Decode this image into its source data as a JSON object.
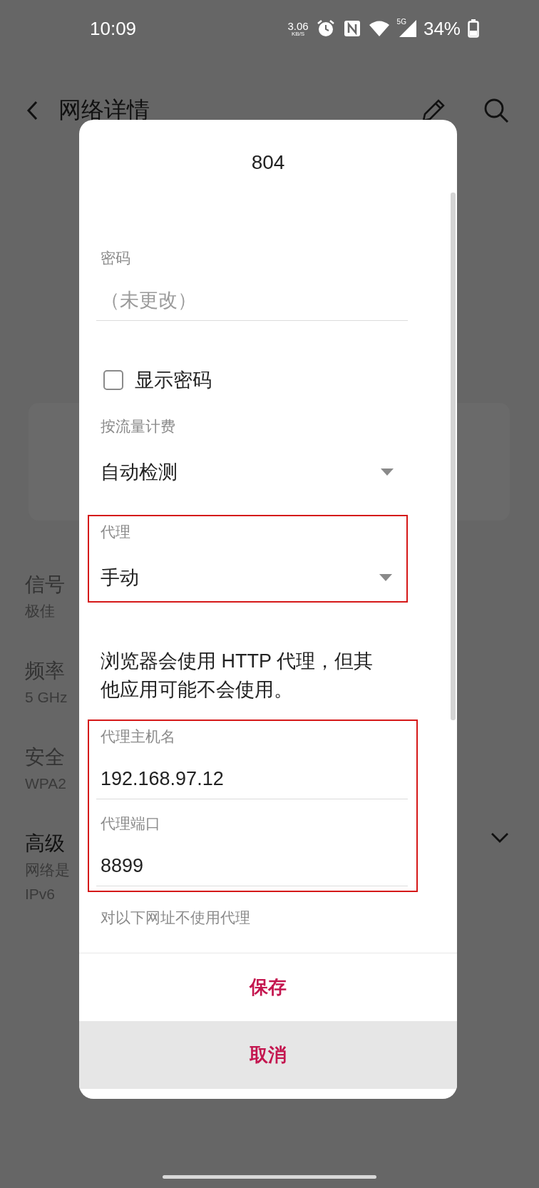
{
  "status_bar": {
    "time": "10:09",
    "net_speed": "3.06",
    "net_speed_unit": "KB/S",
    "network": "5G",
    "battery": "34%"
  },
  "page": {
    "title": "网络详情",
    "items": [
      {
        "label": "信号",
        "value": "极佳"
      },
      {
        "label": "频率",
        "value": "5 GHz"
      },
      {
        "label": "安全",
        "value": "WPA2"
      }
    ],
    "advanced": {
      "label": "高级",
      "lines": [
        "网络是",
        "IPv6"
      ]
    }
  },
  "dialog": {
    "title": "804",
    "password": {
      "label": "密码",
      "placeholder": "（未更改）"
    },
    "show_password": {
      "label": "显示密码",
      "checked": false
    },
    "metered": {
      "label": "按流量计费",
      "value": "自动检测"
    },
    "proxy": {
      "label": "代理",
      "value": "手动"
    },
    "note": "浏览器会使用 HTTP 代理，但其他应用可能不会使用。",
    "hostname": {
      "label": "代理主机名",
      "value": "192.168.97.12"
    },
    "port": {
      "label": "代理端口",
      "value": "8899"
    },
    "bypass_label": "对以下网址不使用代理",
    "buttons": [
      {
        "label": "保存",
        "kind": "primary"
      },
      {
        "label": "取消",
        "kind": "pressed"
      }
    ]
  }
}
